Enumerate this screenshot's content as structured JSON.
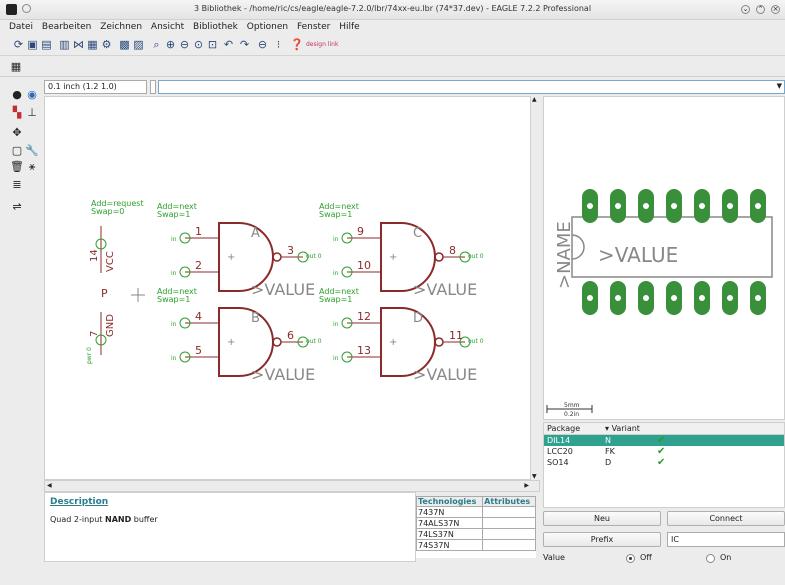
{
  "window": {
    "title": "3 Bibliothek - /home/ric/cs/eagle/eagle-7.2.0/lbr/74xx-eu.lbr (74*37.dev) - EAGLE 7.2.2 Professional"
  },
  "menu": [
    "Datei",
    "Bearbeiten",
    "Zeichnen",
    "Ansicht",
    "Bibliothek",
    "Optionen",
    "Fenster",
    "Hilfe"
  ],
  "toolbar": {
    "design_link_label": "design link"
  },
  "grid": {
    "value": "0.1 inch (1.2 1.0)"
  },
  "schematic": {
    "power_symbol": {
      "attr1": "Add=request",
      "attr2": "Swap=0",
      "vcc_label": "VCC",
      "gnd_label": "GND",
      "pin_vcc": "14",
      "pin_gnd": "7",
      "pwr_label": "pwr 0",
      "p_label": "P"
    },
    "gates": [
      {
        "name": "A",
        "add": "Add=next",
        "swap": "Swap=1",
        "in1": "1",
        "in2": "2",
        "out": "3",
        "value": ">VALUE",
        "in_label": "in",
        "out_label": "out 0"
      },
      {
        "name": "B",
        "add": "Add=next",
        "swap": "Swap=1",
        "in1": "4",
        "in2": "5",
        "out": "6",
        "value": ">VALUE",
        "in_label": "in",
        "out_label": "out 0"
      },
      {
        "name": "C",
        "add": "Add=next",
        "swap": "Swap=1",
        "in1": "9",
        "in2": "10",
        "out": "8",
        "value": ">VALUE",
        "in_label": "in",
        "out_label": "out 0"
      },
      {
        "name": "D",
        "add": "Add=next",
        "swap": "Swap=1",
        "in1": "12",
        "in2": "13",
        "out": "11",
        "value": ">VALUE",
        "in_label": "in",
        "out_label": "out 0"
      }
    ]
  },
  "package": {
    "name_label": ">NAME",
    "value_label": ">VALUE",
    "scale_top": "5mm",
    "scale_bottom": "0.2in"
  },
  "package_table": {
    "headers": [
      "Package",
      "Variant"
    ],
    "rows": [
      {
        "package": "DIL14",
        "variant": "N",
        "selected": true
      },
      {
        "package": "LCC20",
        "variant": "FK",
        "selected": false
      },
      {
        "package": "SO14",
        "variant": "D",
        "selected": false
      }
    ]
  },
  "description": {
    "title": "Description",
    "text_prefix": "Quad 2-input ",
    "text_bold": "NAND",
    "text_suffix": " buffer"
  },
  "technologies": {
    "headers": [
      "Technologies",
      "Attributes"
    ],
    "rows": [
      "7437N",
      "74ALS37N",
      "74LS37N",
      "74S37N"
    ]
  },
  "buttons": {
    "new": "Neu",
    "connect": "Connect",
    "prefix": "Prefix"
  },
  "prefix_value": "IC",
  "value_row": {
    "label": "Value",
    "off": "Off",
    "on": "On"
  },
  "colors": {
    "gate": "#8b2a2a",
    "pin": "#2ea02e",
    "pad": "#3a8f3a",
    "accent": "#2ea28f"
  }
}
